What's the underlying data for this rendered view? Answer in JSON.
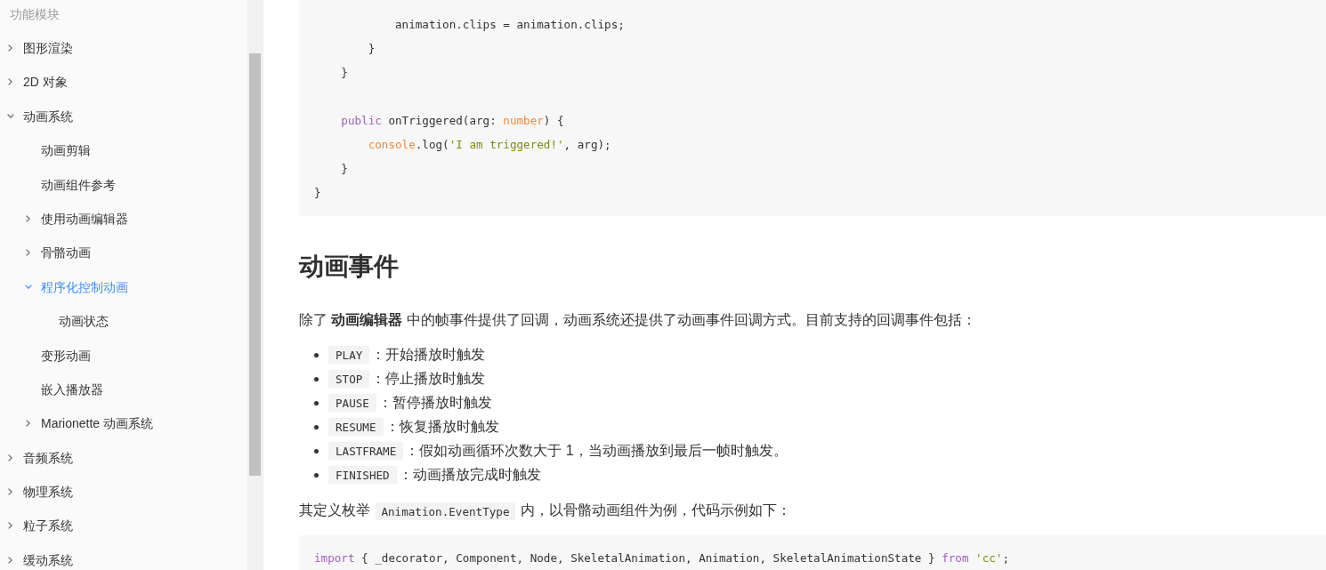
{
  "sidebar": {
    "heading": "功能模块",
    "items": [
      {
        "label": "图形渲染",
        "kind": "folder",
        "expanded": false,
        "selected": false
      },
      {
        "label": "2D 对象",
        "kind": "folder",
        "expanded": false,
        "selected": false
      },
      {
        "label": "动画系统",
        "kind": "folder",
        "expanded": true,
        "selected": false,
        "children": [
          {
            "label": "动画剪辑",
            "kind": "page",
            "selected": false
          },
          {
            "label": "动画组件参考",
            "kind": "page",
            "selected": false
          },
          {
            "label": "使用动画编辑器",
            "kind": "folder",
            "expanded": false,
            "selected": false
          },
          {
            "label": "骨骼动画",
            "kind": "folder",
            "expanded": false,
            "selected": false
          },
          {
            "label": "程序化控制动画",
            "kind": "folder",
            "expanded": true,
            "selected": true,
            "children": [
              {
                "label": "动画状态",
                "kind": "page",
                "selected": false
              }
            ]
          },
          {
            "label": "变形动画",
            "kind": "page",
            "selected": false
          },
          {
            "label": "嵌入播放器",
            "kind": "page",
            "selected": false
          },
          {
            "label": "Marionette 动画系统",
            "kind": "folder",
            "expanded": false,
            "selected": false
          }
        ]
      },
      {
        "label": "音频系统",
        "kind": "folder",
        "expanded": false,
        "selected": false
      },
      {
        "label": "物理系统",
        "kind": "folder",
        "expanded": false,
        "selected": false
      },
      {
        "label": "粒子系统",
        "kind": "folder",
        "expanded": false,
        "selected": false
      },
      {
        "label": "缓动系统",
        "kind": "folder",
        "expanded": false,
        "selected": false
      }
    ]
  },
  "content": {
    "code_block_top": {
      "lines": [
        {
          "kind": "code",
          "tokens": [
            {
              "kind": "plain",
              "text": "            animation.clips = animation.clips;"
            }
          ]
        },
        {
          "kind": "code",
          "tokens": [
            {
              "kind": "plain",
              "text": "        }"
            }
          ]
        },
        {
          "kind": "code",
          "tokens": [
            {
              "kind": "plain",
              "text": "    }"
            }
          ]
        },
        {
          "kind": "blank"
        },
        {
          "kind": "code",
          "tokens": [
            {
              "kind": "keyword",
              "text": "    public"
            },
            {
              "kind": "plain",
              "text": " onTriggered(arg: "
            },
            {
              "kind": "type",
              "text": "number"
            },
            {
              "kind": "plain",
              "text": ") {"
            }
          ]
        },
        {
          "kind": "code",
          "tokens": [
            {
              "kind": "builtin",
              "text": "        console"
            },
            {
              "kind": "plain",
              "text": ".log("
            },
            {
              "kind": "string",
              "text": "'I am triggered!'"
            },
            {
              "kind": "plain",
              "text": ", arg);"
            }
          ]
        },
        {
          "kind": "code",
          "tokens": [
            {
              "kind": "plain",
              "text": "    }"
            }
          ]
        },
        {
          "kind": "code",
          "tokens": [
            {
              "kind": "plain",
              "text": "}"
            }
          ]
        }
      ]
    },
    "heading": "动画事件",
    "intro": "除了 **动画编辑器** 中的帧事件提供了回调，动画系统还提供了动画事件回调方式。目前支持的回调事件包括：",
    "events": [
      {
        "code": "PLAY",
        "text": "：开始播放时触发"
      },
      {
        "code": "STOP",
        "text": "：停止播放时触发"
      },
      {
        "code": "PAUSE",
        "text": "：暂停播放时触发"
      },
      {
        "code": "RESUME",
        "text": "：恢复播放时触发"
      },
      {
        "code": "LASTFRAME",
        "text": "：假如动画循环次数大于 1，当动画播放到最后一帧时触发。"
      },
      {
        "code": "FINISHED",
        "text": "：动画播放完成时触发"
      }
    ],
    "enum_note": [
      {
        "kind": "text",
        "text": "其定义枚举 "
      },
      {
        "kind": "code",
        "text": "Animation.EventType"
      },
      {
        "kind": "text",
        "text": " 内，以骨骼动画组件为例，代码示例如下："
      }
    ],
    "code_block_bottom": {
      "lines": [
        {
          "kind": "code",
          "tokens": [
            {
              "kind": "keyword",
              "text": "import"
            },
            {
              "kind": "plain",
              "text": " { _decorator, Component, Node, SkeletalAnimation, Animation, SkeletalAnimationState } "
            },
            {
              "kind": "keyword",
              "text": "from "
            },
            {
              "kind": "string",
              "text": "'cc'"
            },
            {
              "kind": "plain",
              "text": ";"
            }
          ]
        }
      ]
    }
  }
}
